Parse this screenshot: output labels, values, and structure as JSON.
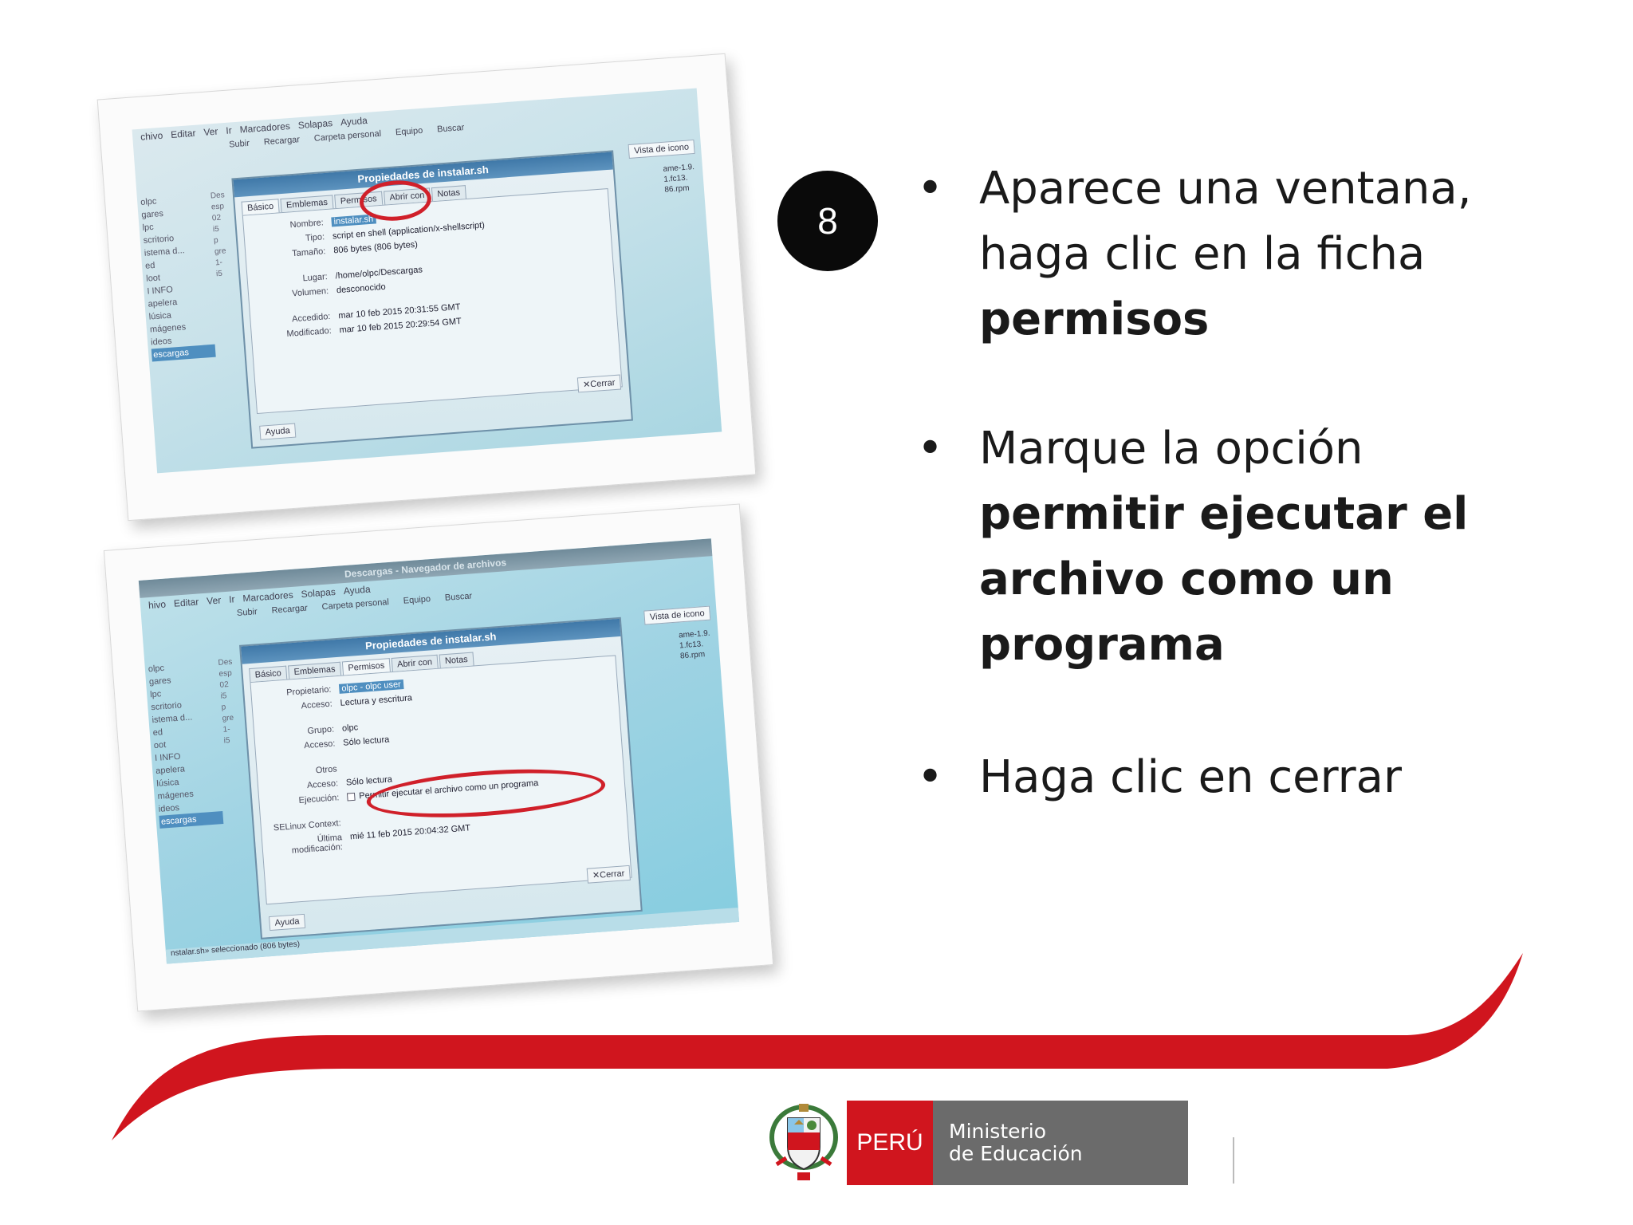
{
  "step_number": "8",
  "instructions": {
    "b1_line1": "Aparece una ventana,",
    "b1_line2": "haga clic en la ficha",
    "b1_bold": "permisos",
    "b2_line1": "Marque la opción",
    "b2_bold1": "permitir ejecutar el",
    "b2_bold2": "archivo como un",
    "b2_bold3": "programa",
    "b3_line1": "Haga clic en cerrar",
    "bullet_glyph": "•"
  },
  "logo": {
    "peru": "PERÚ",
    "ministerio_l1": "Ministerio",
    "ministerio_l2": "de Educación",
    "escudo_icon": "coat-of-arms-icon"
  },
  "colors": {
    "red": "#d0151e",
    "gray": "#6b6b6b",
    "badge": "#0a0a0a"
  },
  "shot_top": {
    "menu": [
      "chivo",
      "Editar",
      "Ver",
      "Ir",
      "Marcadores",
      "Solapas",
      "Ayuda"
    ],
    "toolbar": [
      "Subir",
      "Recargar",
      "Carpeta personal",
      "Equipo",
      "Buscar"
    ],
    "vista": "Vista de icono",
    "sidebar": [
      "olpc",
      "gares",
      "lpc",
      "scritorio",
      "istema d...",
      "ed",
      "loot",
      "I INFO",
      "apelera",
      "lúsica",
      "mágenes",
      "ideos",
      "escargas"
    ],
    "filepane": [
      "Des",
      "esp",
      "02",
      "i5",
      "p",
      "gre",
      "1-",
      "i5"
    ],
    "rightfiles": [
      "ame-1.9.",
      "1.fc13.",
      "86.rpm"
    ],
    "dialog_title": "Propiedades de instalar.sh",
    "tabs": [
      "Básico",
      "Emblemas",
      "Permisos",
      "Abrir con",
      "Notas"
    ],
    "rows": [
      {
        "k": "Nombre:",
        "v": "instalar.sh"
      },
      {
        "k": "Tipo:",
        "v": "script en shell (application/x-shellscript)"
      },
      {
        "k": "Tamaño:",
        "v": "806 bytes (806 bytes)"
      },
      {
        "k": "Lugar:",
        "v": "/home/olpc/Descargas"
      },
      {
        "k": "Volumen:",
        "v": "desconocido"
      },
      {
        "k": "Accedido:",
        "v": "mar 10 feb 2015 20:31:55 GMT"
      },
      {
        "k": "Modificado:",
        "v": "mar 10 feb 2015 20:29:54 GMT"
      }
    ],
    "cerrar": "Cerrar",
    "ayuda": "Ayuda"
  },
  "shot_bottom": {
    "window_title": "Descargas - Navegador de archivos",
    "menu": [
      "hivo",
      "Editar",
      "Ver",
      "Ir",
      "Marcadores",
      "Solapas",
      "Ayuda"
    ],
    "toolbar": [
      "Subir",
      "Recargar",
      "Carpeta personal",
      "Equipo",
      "Buscar"
    ],
    "vista": "Vista de icono",
    "sidebar": [
      "olpc",
      "gares",
      "lpc",
      "scritorio",
      "istema d...",
      "ed",
      "oot",
      "I INFO",
      "apelera",
      "lúsica",
      "mágenes",
      "ideos",
      "escargas"
    ],
    "filepane": [
      "Des",
      "esp",
      "02",
      "i5",
      "p",
      "gre",
      "1-",
      "i5"
    ],
    "rightfiles": [
      "ame-1.9.",
      "1.fc13.",
      "86.rpm"
    ],
    "dialog_title": "Propiedades de instalar.sh",
    "tabs": [
      "Básico",
      "Emblemas",
      "Permisos",
      "Abrir con",
      "Notas"
    ],
    "propietario_k": "Propietario:",
    "propietario_v": "olpc - olpc user",
    "acceso1_k": "Acceso:",
    "acceso1_v": "Lectura y escritura",
    "grupo_k": "Grupo:",
    "grupo_v": "olpc",
    "acceso2_k": "Acceso:",
    "acceso2_v": "Sólo lectura",
    "otros_k": "Otros",
    "acceso3_k": "Acceso:",
    "acceso3_v": "Sólo lectura",
    "ejecucion_k": "Ejecución:",
    "ejecucion_v": "Permitir ejecutar el archivo como un programa",
    "selinux_k": "SELinux Context:",
    "ultima_k": "Última modificación:",
    "ultima_v": "mié 11 feb 2015 20:04:32 GMT",
    "cerrar": "Cerrar",
    "ayuda": "Ayuda",
    "status": "nstalar.sh» seleccionado (806 bytes)"
  }
}
